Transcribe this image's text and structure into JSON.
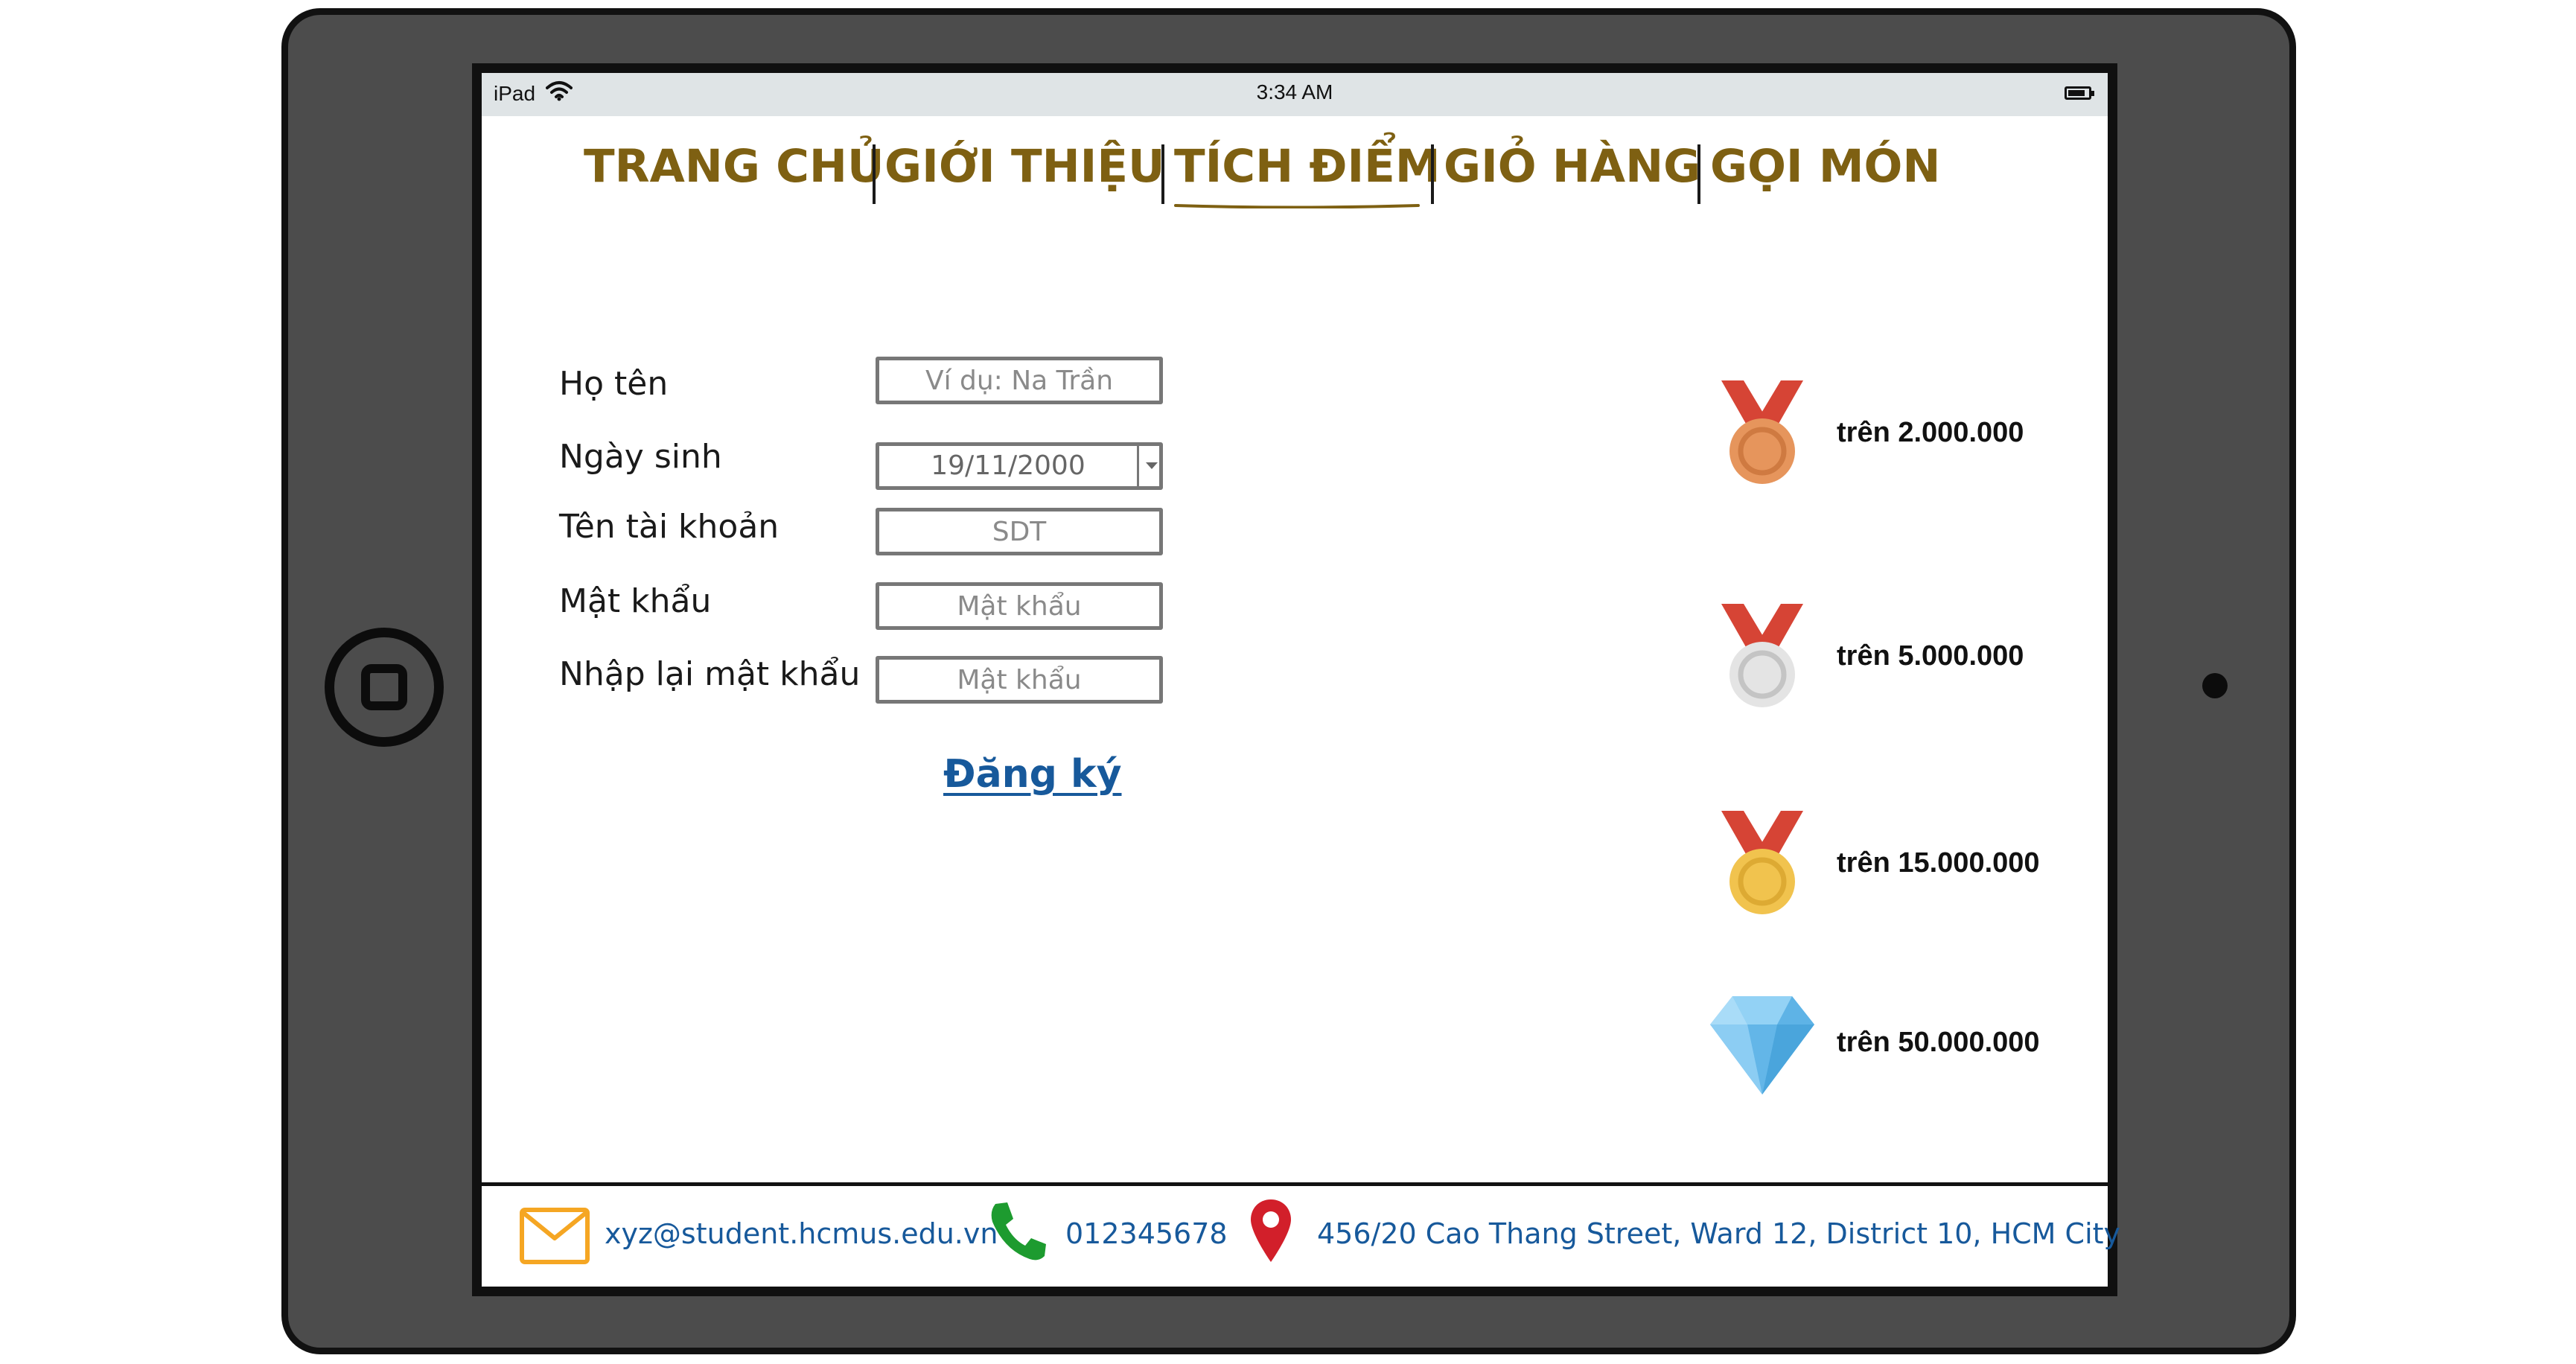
{
  "status_bar": {
    "device": "iPad",
    "time": "3:34 AM"
  },
  "nav": {
    "items": [
      {
        "label": "TRANG CHỦ"
      },
      {
        "label": "GIỚI THIỆU"
      },
      {
        "label": "TÍCH ĐIỂM",
        "active": true
      },
      {
        "label": "GIỎ HÀNG"
      },
      {
        "label": "GỌI MÓN"
      }
    ],
    "color": "#7e6012"
  },
  "form": {
    "fields": [
      {
        "label": "Họ tên",
        "placeholder": "Ví dụ: Na Trần",
        "value": ""
      },
      {
        "label": "Ngày sinh",
        "value": "19/11/2000"
      },
      {
        "label": "Tên tài khoản",
        "placeholder": "SDT",
        "value": ""
      },
      {
        "label": "Mật khẩu",
        "placeholder": "Mật khẩu",
        "value": ""
      },
      {
        "label": "Nhập lại mật khẩu",
        "placeholder": "Mật khẩu",
        "value": ""
      }
    ],
    "submit_label": "Đăng ký",
    "link_color": "#17599b"
  },
  "tiers": [
    {
      "icon": "bronze-medal-icon",
      "label": "trên 2.000.000"
    },
    {
      "icon": "silver-medal-icon",
      "label": "trên 5.000.000"
    },
    {
      "icon": "gold-medal-icon",
      "label": "trên 15.000.000"
    },
    {
      "icon": "diamond-icon",
      "label": "trên 50.000.000"
    }
  ],
  "footer": {
    "email": "xyz@student.hcmus.edu.vn",
    "phone": "012345678",
    "address": "456/20 Cao Thang Street, Ward 12, District 10, HCM City",
    "icons": [
      "mail-icon",
      "phone-icon",
      "location-pin-icon"
    ]
  }
}
